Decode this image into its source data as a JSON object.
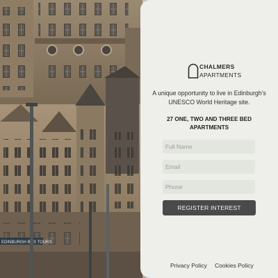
{
  "brand": {
    "name_line1": "CHALMERS",
    "name_line2": "APARTMENTS",
    "logo_icon": "arch-doorway-icon"
  },
  "intro": {
    "tagline": "A unique opportunity to live in Edinburgh's UNESCO World Heritage site.",
    "subhead": "27 ONE, TWO AND THREE BED APARTMENTS"
  },
  "form": {
    "full_name_placeholder": "Full Name",
    "email_placeholder": "Email",
    "phone_placeholder": "Phone",
    "submit_label": "REGISTER INTEREST"
  },
  "background": {
    "street_sign_text": "EDINBURGH BUS TOURS"
  },
  "footer": {
    "privacy_label": "Privacy Policy",
    "cookies_label": "Cookies Policy"
  },
  "colors": {
    "panel_bg": "#eeefeb",
    "field_bg": "#e3e5df",
    "button_bg": "#4a4a4a",
    "text_dark": "#2a2a2a"
  }
}
